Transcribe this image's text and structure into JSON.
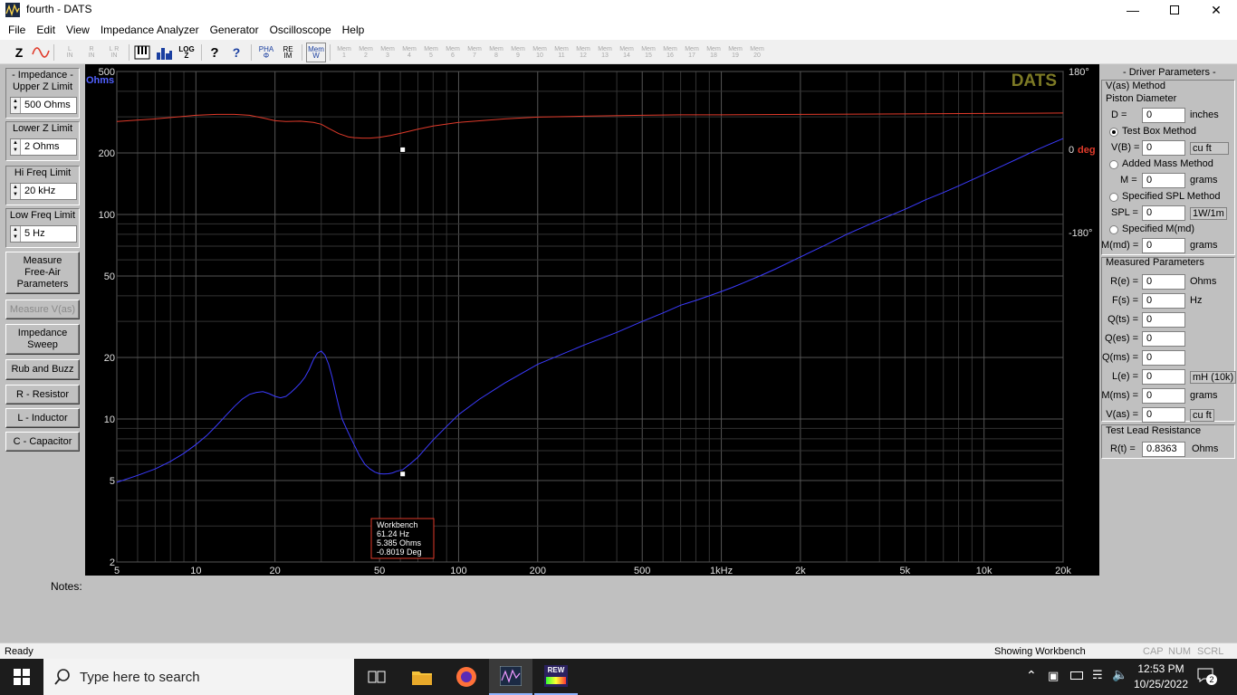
{
  "window": {
    "title": "fourth - DATS"
  },
  "menu": [
    "File",
    "Edit",
    "View",
    "Impedance Analyzer",
    "Generator",
    "Oscilloscope",
    "Help"
  ],
  "toolbar": {
    "z_label": "Z",
    "l_in": "L\nIN",
    "r_in": "R\nIN",
    "lr_in": "L R\nIN",
    "log_label": "LOG\nZ",
    "help_q": "?",
    "help_arrow": "?",
    "pha_label": "PHA\nΦ",
    "reim_label": "RE\nIM",
    "mem_w": "Mem\nW",
    "mem_labels": [
      "Mem\n1",
      "Mem\n2",
      "Mem\n3",
      "Mem\n4",
      "Mem\n5",
      "Mem\n6",
      "Mem\n7",
      "Mem\n8",
      "Mem\n9",
      "Mem\n10",
      "Mem\n11",
      "Mem\n12",
      "Mem\n13",
      "Mem\n14",
      "Mem\n15",
      "Mem\n16",
      "Mem\n17",
      "Mem\n18",
      "Mem\n19",
      "Mem\n20"
    ]
  },
  "left": {
    "impedance_group": "- Impedance -",
    "upper_label": "Upper Z Limit",
    "upper_value": "500 Ohms",
    "lower_label": "Lower Z Limit",
    "lower_value": "2 Ohms",
    "hifreq_label": "Hi Freq Limit",
    "hifreq_value": "20 kHz",
    "lowfreq_label": "Low Freq Limit",
    "lowfreq_value": "5 Hz",
    "btn_free_air": "Measure\nFree-Air\nParameters",
    "btn_vas": "Measure V(as)",
    "btn_sweep": "Impedance\nSweep",
    "btn_rub": "Rub and Buzz",
    "btn_r": "R - Resistor",
    "btn_l": "L - Inductor",
    "btn_c": "C - Capacitor"
  },
  "chart_data": {
    "type": "line",
    "brand": "DATS",
    "ylabel": "Ohms",
    "ylabel_right": "deg",
    "y_scale": "log",
    "x_scale": "log",
    "xlim": [
      5,
      20000
    ],
    "ylim": [
      2,
      500
    ],
    "phase_lim": [
      -180,
      180
    ],
    "x_ticks": [
      "5",
      "10",
      "20",
      "50",
      "100",
      "200",
      "500",
      "1kHz",
      "2k",
      "5k",
      "10k",
      "20k"
    ],
    "y_ticks": [
      "500",
      "200",
      "100",
      "50",
      "20",
      "10",
      "5",
      "2"
    ],
    "phase_ticks": [
      "180°",
      "0 deg",
      "-180°"
    ],
    "grid": true,
    "series": [
      {
        "color": "#3b3bff",
        "x": [
          5,
          6,
          7,
          8,
          9,
          10,
          11,
          12,
          13,
          14,
          15,
          16,
          17,
          18,
          19,
          20,
          21,
          22,
          23,
          24,
          25,
          26,
          27,
          28,
          29,
          30,
          31,
          32,
          33,
          34,
          35,
          36,
          38,
          40,
          42,
          44,
          46,
          48,
          50,
          52,
          54,
          56,
          58,
          61.24,
          65,
          70,
          75,
          80,
          90,
          100,
          120,
          150,
          200,
          300,
          400,
          500,
          600,
          700,
          800,
          900,
          1000,
          1100,
          1200,
          1400,
          1600,
          2000,
          2500,
          3000,
          4000,
          5000,
          6000,
          7000,
          8000,
          10000,
          12000,
          14000,
          16000,
          18000,
          20000
        ],
        "y": [
          4.9,
          5.3,
          5.7,
          6.2,
          6.8,
          7.5,
          8.3,
          9.3,
          10.4,
          11.5,
          12.5,
          13.2,
          13.5,
          13.6,
          13.3,
          12.9,
          12.7,
          12.9,
          13.5,
          14.2,
          15,
          16,
          17.5,
          19.5,
          21,
          21.5,
          20.5,
          18.5,
          16,
          13.5,
          11.5,
          10,
          8.6,
          7.5,
          6.6,
          6,
          5.7,
          5.5,
          5.4,
          5.385,
          5.4,
          5.45,
          5.55,
          5.65,
          6,
          6.5,
          7.2,
          7.9,
          9.2,
          10.5,
          12.5,
          15,
          18.5,
          23,
          26.5,
          30,
          33,
          36,
          38,
          40,
          42,
          44,
          46,
          50,
          54,
          62,
          71,
          80,
          94,
          106,
          118,
          128,
          138,
          157,
          175,
          192,
          208,
          222,
          235
        ]
      },
      {
        "color": "#e03a2a",
        "x": [
          5,
          7,
          10,
          12,
          14,
          16,
          18,
          20,
          22,
          25,
          28,
          30,
          32,
          35,
          38,
          40,
          43,
          46,
          50,
          55,
          61.24,
          70,
          80,
          100,
          150,
          200,
          300,
          500,
          700,
          1000,
          2000,
          5000,
          10000,
          20000
        ],
        "y": [
          62,
          68,
          76,
          78,
          78,
          76,
          70,
          64,
          62,
          63,
          60,
          56,
          47,
          35,
          28,
          26,
          25,
          25,
          27,
          31,
          37,
          45,
          52,
          60,
          68,
          72,
          74,
          76,
          77,
          77,
          78,
          79,
          80,
          81
        ]
      }
    ],
    "marker": {
      "x": 61.24,
      "impedance": 5.385,
      "phase": -0.8019
    },
    "tooltip": [
      "Workbench",
      "61.24 Hz",
      "5.385 Ohms",
      "-0.8019 Deg"
    ]
  },
  "right": {
    "title": "- Driver Parameters -",
    "vas_method": "V(as) Method",
    "piston_label": "Piston Diameter",
    "d_label": "D =",
    "d_value": "0",
    "d_unit": "inches",
    "test_box": "Test Box Method",
    "vb_label": "V(B) =",
    "vb_value": "0",
    "vb_unit": "cu ft",
    "added_mass": "Added Mass Method",
    "m_label": "M =",
    "m_value": "0",
    "m_unit": "grams",
    "spl_method": "Specified SPL Method",
    "spl_label": "SPL =",
    "spl_value": "0",
    "spl_unit": "1W/1m",
    "mmd_method": "Specified M(md)",
    "mmd_label": "M(md) =",
    "mmd_value": "0",
    "mmd_unit": "grams",
    "measured_title": "Measured Parameters",
    "params": [
      {
        "label": "R(e) =",
        "value": "0",
        "unit": "Ohms"
      },
      {
        "label": "F(s) =",
        "value": "0",
        "unit": "Hz"
      },
      {
        "label": "Q(ts) =",
        "value": "0",
        "unit": ""
      },
      {
        "label": "Q(es) =",
        "value": "0",
        "unit": ""
      },
      {
        "label": "Q(ms) =",
        "value": "0",
        "unit": ""
      },
      {
        "label": "L(e) =",
        "value": "0",
        "unit": "mH (10k)"
      },
      {
        "label": "M(ms) =",
        "value": "0",
        "unit": "grams"
      },
      {
        "label": "V(as) =",
        "value": "0",
        "unit": "cu ft"
      }
    ],
    "lead_title": "Test Lead Resistance",
    "rt_label": "R(t) =",
    "rt_value": "0.8363",
    "rt_unit": "Ohms"
  },
  "notes_label": "Notes:",
  "status": {
    "left": "Ready",
    "center": "Showing Workbench",
    "cap": "CAP",
    "num": "NUM",
    "scrl": "SCRL"
  },
  "taskbar": {
    "search_placeholder": "Type here to search",
    "time": "12:53 PM",
    "date": "10/25/2022",
    "notif_count": "2",
    "rew_label": "REW"
  }
}
